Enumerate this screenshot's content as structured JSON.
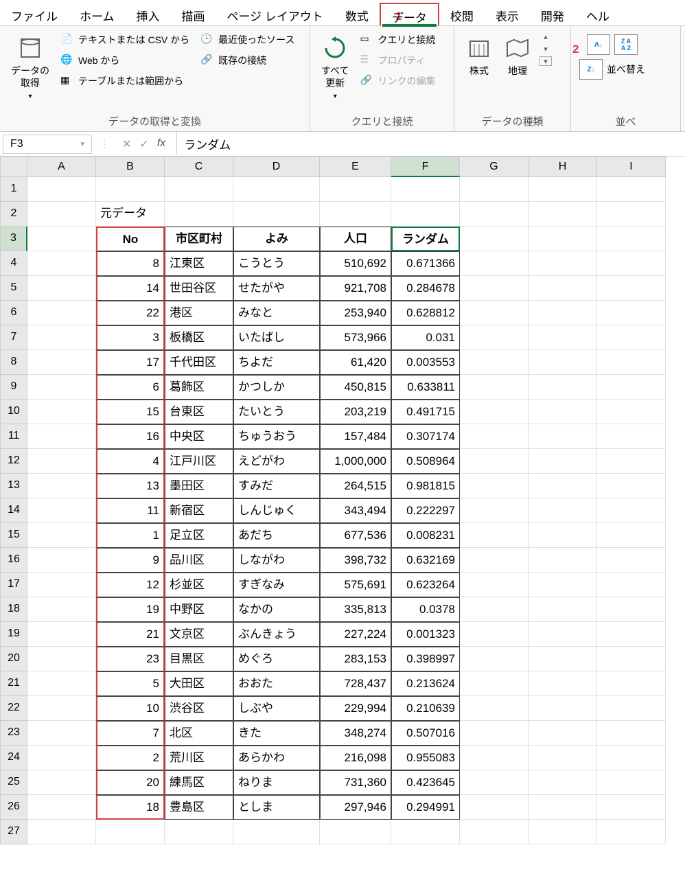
{
  "menu": {
    "items": [
      "ファイル",
      "ホーム",
      "挿入",
      "描画",
      "ページ レイアウト",
      "数式",
      "データ",
      "校閲",
      "表示",
      "開発",
      "ヘル"
    ],
    "activeIndex": 6
  },
  "annotations": {
    "one": "1",
    "two": "2"
  },
  "ribbon": {
    "group1": {
      "label": "データの取得と変換",
      "getData": "データの\n取得",
      "textCsv": "テキストまたは CSV から",
      "web": "Web から",
      "table": "テーブルまたは範囲から",
      "recent": "最近使ったソース",
      "existing": "既存の接続"
    },
    "group2": {
      "label": "クエリと接続",
      "refresh": "すべて\n更新",
      "queryConn": "クエリと接続",
      "properties": "プロパティ",
      "editLinks": "リンクの編集"
    },
    "group3": {
      "label": "データの種類",
      "stock": "株式",
      "geo": "地理"
    },
    "group4": {
      "label": "並べ",
      "sortAZ": "A→Z",
      "sortZA": "Z→A",
      "sort": "並べ替え"
    }
  },
  "formulaBar": {
    "nameBox": "F3",
    "formula": "ランダム"
  },
  "columns": [
    "A",
    "B",
    "C",
    "D",
    "E",
    "F",
    "G",
    "H",
    "I"
  ],
  "sheet": {
    "b2": "元データ",
    "headers": {
      "no": "No",
      "ward": "市区町村",
      "yomi": "よみ",
      "pop": "人口",
      "rand": "ランダム"
    },
    "rows": [
      {
        "no": "8",
        "ward": "江東区",
        "yomi": "こうとう",
        "pop": "510,692",
        "rand": "0.671366"
      },
      {
        "no": "14",
        "ward": "世田谷区",
        "yomi": "せたがや",
        "pop": "921,708",
        "rand": "0.284678"
      },
      {
        "no": "22",
        "ward": "港区",
        "yomi": "みなと",
        "pop": "253,940",
        "rand": "0.628812"
      },
      {
        "no": "3",
        "ward": "板橋区",
        "yomi": "いたばし",
        "pop": "573,966",
        "rand": "0.031"
      },
      {
        "no": "17",
        "ward": "千代田区",
        "yomi": "ちよだ",
        "pop": "61,420",
        "rand": "0.003553"
      },
      {
        "no": "6",
        "ward": "葛飾区",
        "yomi": "かつしか",
        "pop": "450,815",
        "rand": "0.633811"
      },
      {
        "no": "15",
        "ward": "台東区",
        "yomi": "たいとう",
        "pop": "203,219",
        "rand": "0.491715"
      },
      {
        "no": "16",
        "ward": "中央区",
        "yomi": "ちゅうおう",
        "pop": "157,484",
        "rand": "0.307174"
      },
      {
        "no": "4",
        "ward": "江戸川区",
        "yomi": "えどがわ",
        "pop": "1,000,000",
        "rand": "0.508964"
      },
      {
        "no": "13",
        "ward": "墨田区",
        "yomi": "すみだ",
        "pop": "264,515",
        "rand": "0.981815"
      },
      {
        "no": "11",
        "ward": "新宿区",
        "yomi": "しんじゅく",
        "pop": "343,494",
        "rand": "0.222297"
      },
      {
        "no": "1",
        "ward": "足立区",
        "yomi": "あだち",
        "pop": "677,536",
        "rand": "0.008231"
      },
      {
        "no": "9",
        "ward": "品川区",
        "yomi": "しながわ",
        "pop": "398,732",
        "rand": "0.632169"
      },
      {
        "no": "12",
        "ward": "杉並区",
        "yomi": "すぎなみ",
        "pop": "575,691",
        "rand": "0.623264"
      },
      {
        "no": "19",
        "ward": "中野区",
        "yomi": "なかの",
        "pop": "335,813",
        "rand": "0.0378"
      },
      {
        "no": "21",
        "ward": "文京区",
        "yomi": "ぶんきょう",
        "pop": "227,224",
        "rand": "0.001323"
      },
      {
        "no": "23",
        "ward": "目黒区",
        "yomi": "めぐろ",
        "pop": "283,153",
        "rand": "0.398997"
      },
      {
        "no": "5",
        "ward": "大田区",
        "yomi": "おおた",
        "pop": "728,437",
        "rand": "0.213624"
      },
      {
        "no": "10",
        "ward": "渋谷区",
        "yomi": "しぶや",
        "pop": "229,994",
        "rand": "0.210639"
      },
      {
        "no": "7",
        "ward": "北区",
        "yomi": "きた",
        "pop": "348,274",
        "rand": "0.507016"
      },
      {
        "no": "2",
        "ward": "荒川区",
        "yomi": "あらかわ",
        "pop": "216,098",
        "rand": "0.955083"
      },
      {
        "no": "20",
        "ward": "練馬区",
        "yomi": "ねりま",
        "pop": "731,360",
        "rand": "0.423645"
      },
      {
        "no": "18",
        "ward": "豊島区",
        "yomi": "としま",
        "pop": "297,946",
        "rand": "0.294991"
      }
    ],
    "rowCount": 27
  }
}
